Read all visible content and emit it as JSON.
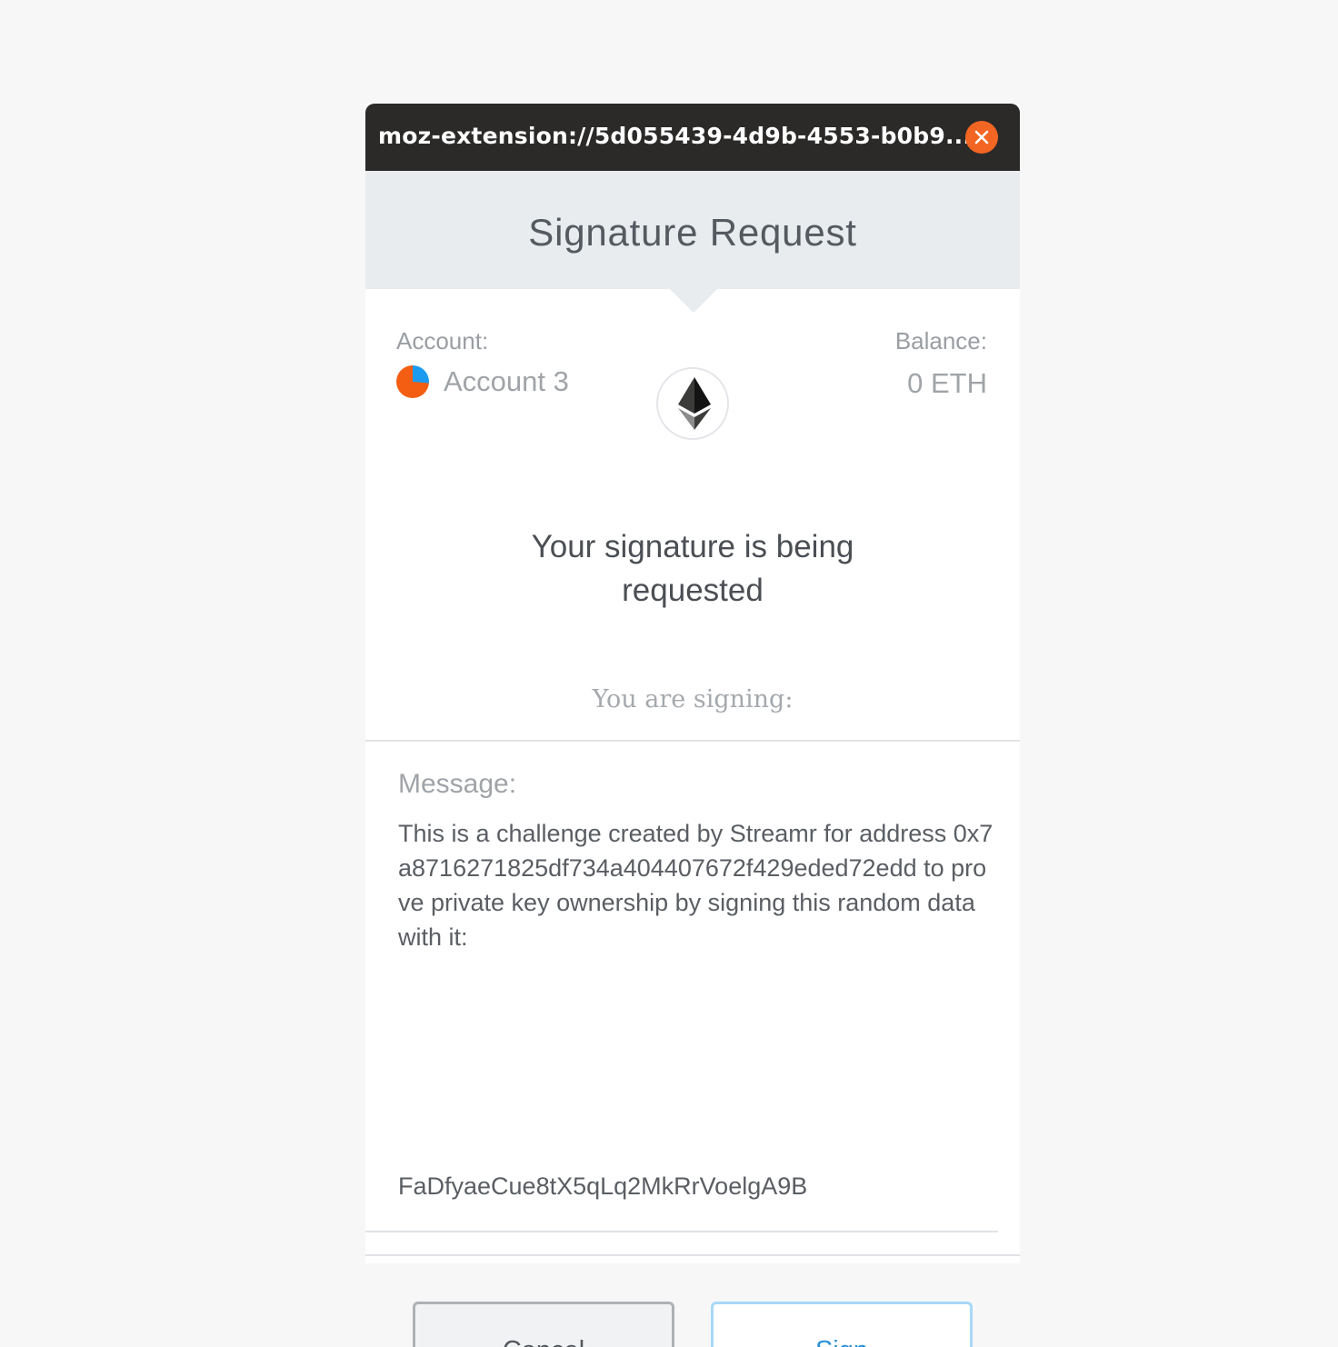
{
  "window": {
    "title": "moz-extension://5d055439-4d9b-4553-b0b9..."
  },
  "header": {
    "title": "Signature Request"
  },
  "account": {
    "label": "Account:",
    "name": "Account 3"
  },
  "balance": {
    "label": "Balance:",
    "value": "0 ETH"
  },
  "request": {
    "line1": "Your signature is being",
    "line2": "requested"
  },
  "signing_label": "You are signing:",
  "message": {
    "label": "Message:",
    "body": "This is a challenge created by Streamr for address 0x7a8716271825df734a404407672f429eded72edd to prove private key ownership by signing this random data with it:",
    "random": "FaDfyaeCue8tX5qLq2MkRrVoelgA9B"
  },
  "buttons": {
    "cancel": "Cancel",
    "sign": "Sign"
  },
  "icons": {
    "close": "close-icon",
    "avatar": "identicon",
    "ethereum": "ethereum-icon"
  },
  "colors": {
    "titlebar": "#2b2a29",
    "close": "#f26522",
    "header": "#e8ecef",
    "sign_accent": "#2a90d9"
  }
}
